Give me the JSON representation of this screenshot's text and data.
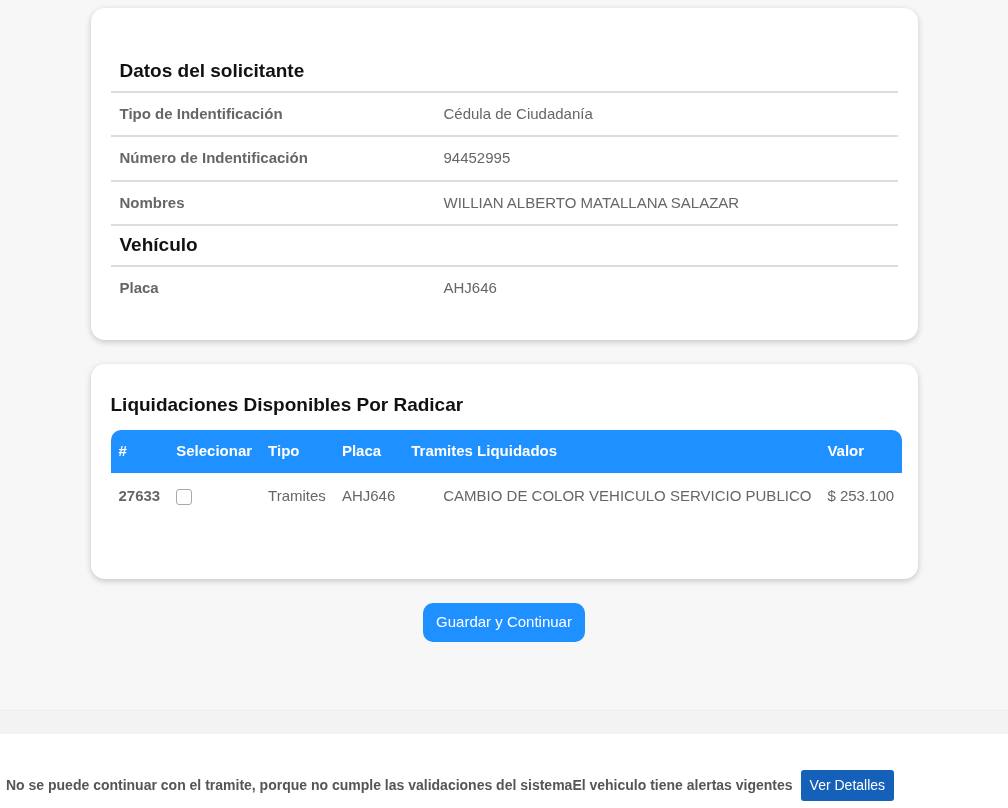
{
  "sections": [
    {
      "title": "Datos del solicitante",
      "rows": [
        {
          "label": "Tipo de Indentificación",
          "value": "Cédula de Ciudadanía"
        },
        {
          "label": "Número de Indentificación",
          "value": "94452995"
        },
        {
          "label": "Nombres",
          "value": "WILLIAN ALBERTO MATALLANA SALAZAR"
        }
      ]
    },
    {
      "title": "Vehículo",
      "rows": [
        {
          "label": "Placa",
          "value": "AHJ646"
        }
      ]
    }
  ],
  "liquidaciones": {
    "title": "Liquidaciones Disponibles Por Radicar",
    "columns": [
      "#",
      "Selecionar",
      "Tipo",
      "Placa",
      "Tramites Liquidados",
      "Valor"
    ],
    "rows": [
      {
        "id": "27633",
        "checked": false,
        "tipo": "Tramites",
        "placa": "AHJ646",
        "tramites": "CAMBIO DE COLOR VEHICULO SERVICIO PUBLICO",
        "valor": "$ 253.100"
      }
    ]
  },
  "submit_button": "Guardar y Continuar",
  "alert": {
    "message": "No se puede continuar con el tramite, porque no cumple las validaciones del sistemaEl vehiculo tiene alertas vigentes",
    "button": "Ver Detalles"
  }
}
